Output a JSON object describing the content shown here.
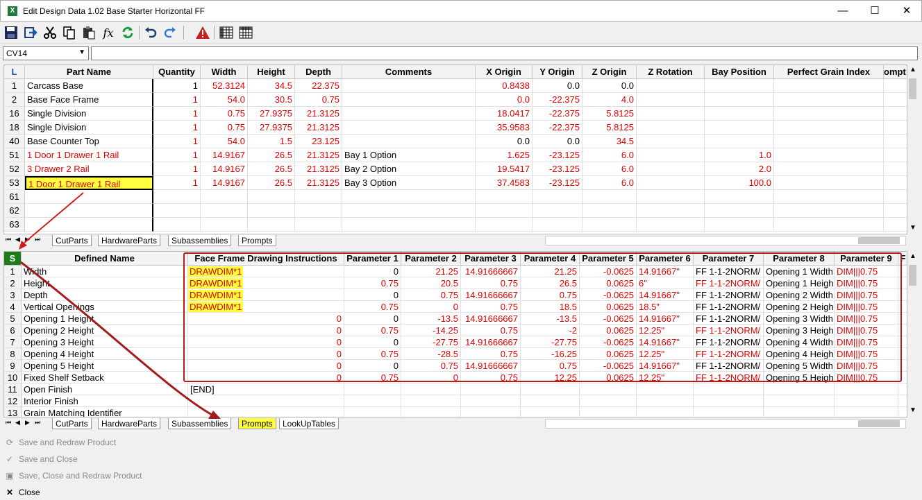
{
  "window": {
    "title": "Edit Design Data 1.02 Base Starter Horizontal FF",
    "app_icon": "X",
    "minimize": "—",
    "maximize": "☐",
    "close": "✕"
  },
  "toolbar": {
    "icons": [
      "save-icon",
      "export-icon",
      "cut-icon",
      "copy-icon",
      "paste-icon",
      "function-icon",
      "refresh-icon",
      "undo-icon",
      "redo-icon",
      "warning-icon",
      "grid-icon",
      "table-icon"
    ]
  },
  "formula": {
    "cell_ref": "CV14",
    "value": ""
  },
  "top_grid": {
    "headers": [
      "L",
      "Part Name",
      "Quantity",
      "Width",
      "Height",
      "Depth",
      "Comments",
      "X Origin",
      "Y Origin",
      "Z Origin",
      "Z Rotation",
      "Bay Position",
      "Perfect Grain Index",
      "ompt V"
    ],
    "rows": [
      {
        "n": "1",
        "name": "Carcass Base",
        "qty": "1",
        "w": "52.3124",
        "h": "34.5",
        "d": "22.375",
        "c": "",
        "x": "0.8438",
        "y": "0.0",
        "z": "0.0",
        "zr": "",
        "bay": "",
        "pgi": "",
        "red": false
      },
      {
        "n": "2",
        "name": "Base Face Frame",
        "qty": "1",
        "w": "54.0",
        "h": "30.5",
        "d": "0.75",
        "c": "",
        "x": "0.0",
        "y": "-22.375",
        "z": "4.0",
        "zr": "",
        "bay": "",
        "pgi": "",
        "red": false
      },
      {
        "n": "16",
        "name": "Single Division",
        "qty": "1",
        "w": "0.75",
        "h": "27.9375",
        "d": "21.3125",
        "c": "",
        "x": "18.0417",
        "y": "-22.375",
        "z": "5.8125",
        "zr": "",
        "bay": "",
        "pgi": "",
        "red": false
      },
      {
        "n": "18",
        "name": "Single Division",
        "qty": "1",
        "w": "0.75",
        "h": "27.9375",
        "d": "21.3125",
        "c": "",
        "x": "35.9583",
        "y": "-22.375",
        "z": "5.8125",
        "zr": "",
        "bay": "",
        "pgi": "",
        "red": false
      },
      {
        "n": "40",
        "name": "Base Counter Top",
        "qty": "1",
        "w": "54.0",
        "h": "1.5",
        "d": "23.125",
        "c": "",
        "x": "0.0",
        "y": "0.0",
        "z": "34.5",
        "zr": "",
        "bay": "",
        "pgi": "",
        "red": false
      },
      {
        "n": "51",
        "name": "1 Door 1 Drawer 1 Rail",
        "qty": "1",
        "w": "14.9167",
        "h": "26.5",
        "d": "21.3125",
        "c": "Bay 1 Option",
        "x": "1.625",
        "y": "-23.125",
        "z": "6.0",
        "zr": "",
        "bay": "1.0",
        "pgi": "",
        "red": true
      },
      {
        "n": "52",
        "name": "3 Drawer 2 Rail",
        "qty": "1",
        "w": "14.9167",
        "h": "26.5",
        "d": "21.3125",
        "c": "Bay 2 Option",
        "x": "19.5417",
        "y": "-23.125",
        "z": "6.0",
        "zr": "",
        "bay": "2.0",
        "pgi": "",
        "red": true
      },
      {
        "n": "53",
        "name": "1 Door 1 Drawer 1 Rail",
        "qty": "1",
        "w": "14.9167",
        "h": "26.5",
        "d": "21.3125",
        "c": "Bay 3 Option",
        "x": "37.4583",
        "y": "-23.125",
        "z": "6.0",
        "zr": "",
        "bay": "100.0",
        "pgi": "",
        "red": true
      },
      {
        "n": "61",
        "name": "",
        "qty": "",
        "w": "",
        "h": "",
        "d": "",
        "c": "",
        "x": "",
        "y": "",
        "z": "",
        "zr": "",
        "bay": "",
        "pgi": "",
        "red": false
      },
      {
        "n": "62",
        "name": "",
        "qty": "",
        "w": "",
        "h": "",
        "d": "",
        "c": "",
        "x": "",
        "y": "",
        "z": "",
        "zr": "",
        "bay": "",
        "pgi": "",
        "red": false
      },
      {
        "n": "63",
        "name": "",
        "qty": "",
        "w": "",
        "h": "",
        "d": "",
        "c": "",
        "x": "",
        "y": "",
        "z": "",
        "zr": "",
        "bay": "",
        "pgi": "",
        "red": false
      }
    ],
    "tabs": [
      "CutParts",
      "HardwareParts",
      "Subassemblies",
      "Prompts"
    ]
  },
  "bottom_grid": {
    "headers": [
      "S",
      "Defined Name",
      "Face Frame Drawing Instructions",
      "Parameter 1",
      "Parameter 2",
      "Parameter 3",
      "Parameter 4",
      "Parameter 5",
      "Parameter 6",
      "Parameter 7",
      "Parameter 8",
      "Parameter 9",
      "F"
    ],
    "rows": [
      {
        "n": "1",
        "name": "Width",
        "ff": "DRAWDIM*1",
        "p1": "0",
        "p2": "21.25",
        "p3": "14.91666667",
        "p4": "21.25",
        "p5": "-0.0625",
        "p6": "14.91667\"",
        "p7": "FF 1-1-2NORM/",
        "p8": "Opening 1 Width",
        "p9": "DIM|||0.75",
        "ffred": true
      },
      {
        "n": "2",
        "name": "Height",
        "ff": "DRAWDIM*1",
        "p1": "0.75",
        "p2": "20.5",
        "p3": "0.75",
        "p4": "26.5",
        "p5": "0.0625",
        "p6": "6\"",
        "p7": "FF 1-1-2NORM/",
        "p8": "Opening 1 Heigh",
        "p9": "DIM|||0.75",
        "ffred": true
      },
      {
        "n": "3",
        "name": "Depth",
        "ff": "DRAWDIM*1",
        "p1": "0",
        "p2": "0.75",
        "p3": "14.91666667",
        "p4": "0.75",
        "p5": "-0.0625",
        "p6": "14.91667\"",
        "p7": "FF 1-1-2NORM/",
        "p8": "Opening 2 Width",
        "p9": "DIM|||0.75",
        "ffred": true
      },
      {
        "n": "4",
        "name": "Vertical Openings",
        "ff": "DRAWDIM*1",
        "p1": "0.75",
        "p2": "0",
        "p3": "0.75",
        "p4": "18.5",
        "p5": "0.0625",
        "p6": "18.5\"",
        "p7": "FF 1-1-2NORM/",
        "p8": "Opening 2 Heigh",
        "p9": "DIM|||0.75",
        "ffred": true
      },
      {
        "n": "5",
        "name": "Opening 1 Height",
        "ff": "0",
        "p1": "0",
        "p2": "-13.5",
        "p3": "14.91666667",
        "p4": "-13.5",
        "p5": "-0.0625",
        "p6": "14.91667\"",
        "p7": "FF 1-1-2NORM/",
        "p8": "Opening 3 Width",
        "p9": "DIM|||0.75",
        "ffred": false
      },
      {
        "n": "6",
        "name": "Opening 2 Height",
        "ff": "0",
        "p1": "0.75",
        "p2": "-14.25",
        "p3": "0.75",
        "p4": "-2",
        "p5": "0.0625",
        "p6": "12.25\"",
        "p7": "FF 1-1-2NORM/",
        "p8": "Opening 3 Heigh",
        "p9": "DIM|||0.75",
        "ffred": false
      },
      {
        "n": "7",
        "name": "Opening 3 Height",
        "ff": "0",
        "p1": "0",
        "p2": "-27.75",
        "p3": "14.91666667",
        "p4": "-27.75",
        "p5": "-0.0625",
        "p6": "14.91667\"",
        "p7": "FF 1-1-2NORM/",
        "p8": "Opening 4 Width",
        "p9": "DIM|||0.75",
        "ffred": false
      },
      {
        "n": "8",
        "name": "Opening 4 Height",
        "ff": "0",
        "p1": "0.75",
        "p2": "-28.5",
        "p3": "0.75",
        "p4": "-16.25",
        "p5": "0.0625",
        "p6": "12.25\"",
        "p7": "FF 1-1-2NORM/",
        "p8": "Opening 4 Heigh",
        "p9": "DIM|||0.75",
        "ffred": false
      },
      {
        "n": "9",
        "name": "Opening 5 Height",
        "ff": "0",
        "p1": "0",
        "p2": "0.75",
        "p3": "14.91666667",
        "p4": "0.75",
        "p5": "-0.0625",
        "p6": "14.91667\"",
        "p7": "FF 1-1-2NORM/",
        "p8": "Opening 5 Width",
        "p9": "DIM|||0.75",
        "ffred": false
      },
      {
        "n": "10",
        "name": "Fixed Shelf Setback",
        "ff": "0",
        "p1": "0.75",
        "p2": "0",
        "p3": "0.75",
        "p4": "12.25",
        "p5": "0.0625",
        "p6": "12.25\"",
        "p7": "FF 1-1-2NORM/",
        "p8": "Opening 5 Heigh",
        "p9": "DIM|||0.75",
        "ffred": false
      },
      {
        "n": "11",
        "name": "Open Finish",
        "ff": "[END]",
        "p1": "",
        "p2": "",
        "p3": "",
        "p4": "",
        "p5": "",
        "p6": "",
        "p7": "",
        "p8": "",
        "p9": "",
        "ffred": false
      },
      {
        "n": "12",
        "name": "Interior Finish",
        "ff": "",
        "p1": "",
        "p2": "",
        "p3": "",
        "p4": "",
        "p5": "",
        "p6": "",
        "p7": "",
        "p8": "",
        "p9": "",
        "ffred": false
      },
      {
        "n": "13",
        "name": "Grain Matching Identifier",
        "ff": "",
        "p1": "",
        "p2": "",
        "p3": "",
        "p4": "",
        "p5": "",
        "p6": "",
        "p7": "",
        "p8": "",
        "p9": "",
        "ffred": false
      }
    ],
    "tabs": [
      "CutParts",
      "HardwareParts",
      "Subassemblies",
      "Prompts",
      "LookUpTables"
    ]
  },
  "actions": [
    {
      "label": "Save and Redraw Product",
      "icon": "redraw-icon",
      "enabled": false
    },
    {
      "label": "Save and Close",
      "icon": "check-icon",
      "enabled": false
    },
    {
      "label": "Save, Close and Redraw Product",
      "icon": "save-close-icon",
      "enabled": false
    },
    {
      "label": "Close",
      "icon": "close-icon",
      "enabled": true
    }
  ],
  "colors": {
    "red": "#e00000",
    "highlight": "#ffff40",
    "accent": "#b51c1c"
  }
}
